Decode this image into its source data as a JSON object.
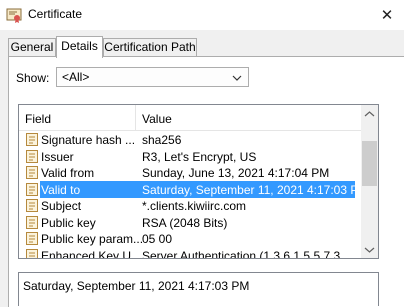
{
  "window": {
    "title": "Certificate",
    "close_glyph": "✕"
  },
  "tabs": [
    {
      "label": "General",
      "active": false
    },
    {
      "label": "Details",
      "active": true
    },
    {
      "label": "Certification Path",
      "active": false
    }
  ],
  "show": {
    "label": "Show:",
    "value": "<All>"
  },
  "table": {
    "columns": [
      "Field",
      "Value"
    ],
    "rows": [
      {
        "field": "Signature hash ...",
        "value": "sha256",
        "selected": false
      },
      {
        "field": "Issuer",
        "value": "R3, Let's Encrypt, US",
        "selected": false
      },
      {
        "field": "Valid from",
        "value": "Sunday, June 13, 2021 4:17:04 PM",
        "selected": false
      },
      {
        "field": "Valid to",
        "value": "Saturday, September 11, 2021 4:17:03 PM",
        "selected": true
      },
      {
        "field": "Subject",
        "value": "*.clients.kiwiirc.com",
        "selected": false
      },
      {
        "field": "Public key",
        "value": "RSA (2048 Bits)",
        "selected": false
      },
      {
        "field": "Public key param...",
        "value": "05 00",
        "selected": false
      },
      {
        "field": "Enhanced Key U...",
        "value": "Server Authentication (1.3.6.1.5.5.7.3...",
        "selected": false
      }
    ]
  },
  "detail": {
    "text": "Saturday, September 11, 2021 4:17:03 PM"
  },
  "colors": {
    "selection": "#3399ff",
    "window_bg": "#f0f0f0"
  },
  "icons": {
    "title": "certificate-icon",
    "field": "document-field-icon"
  }
}
